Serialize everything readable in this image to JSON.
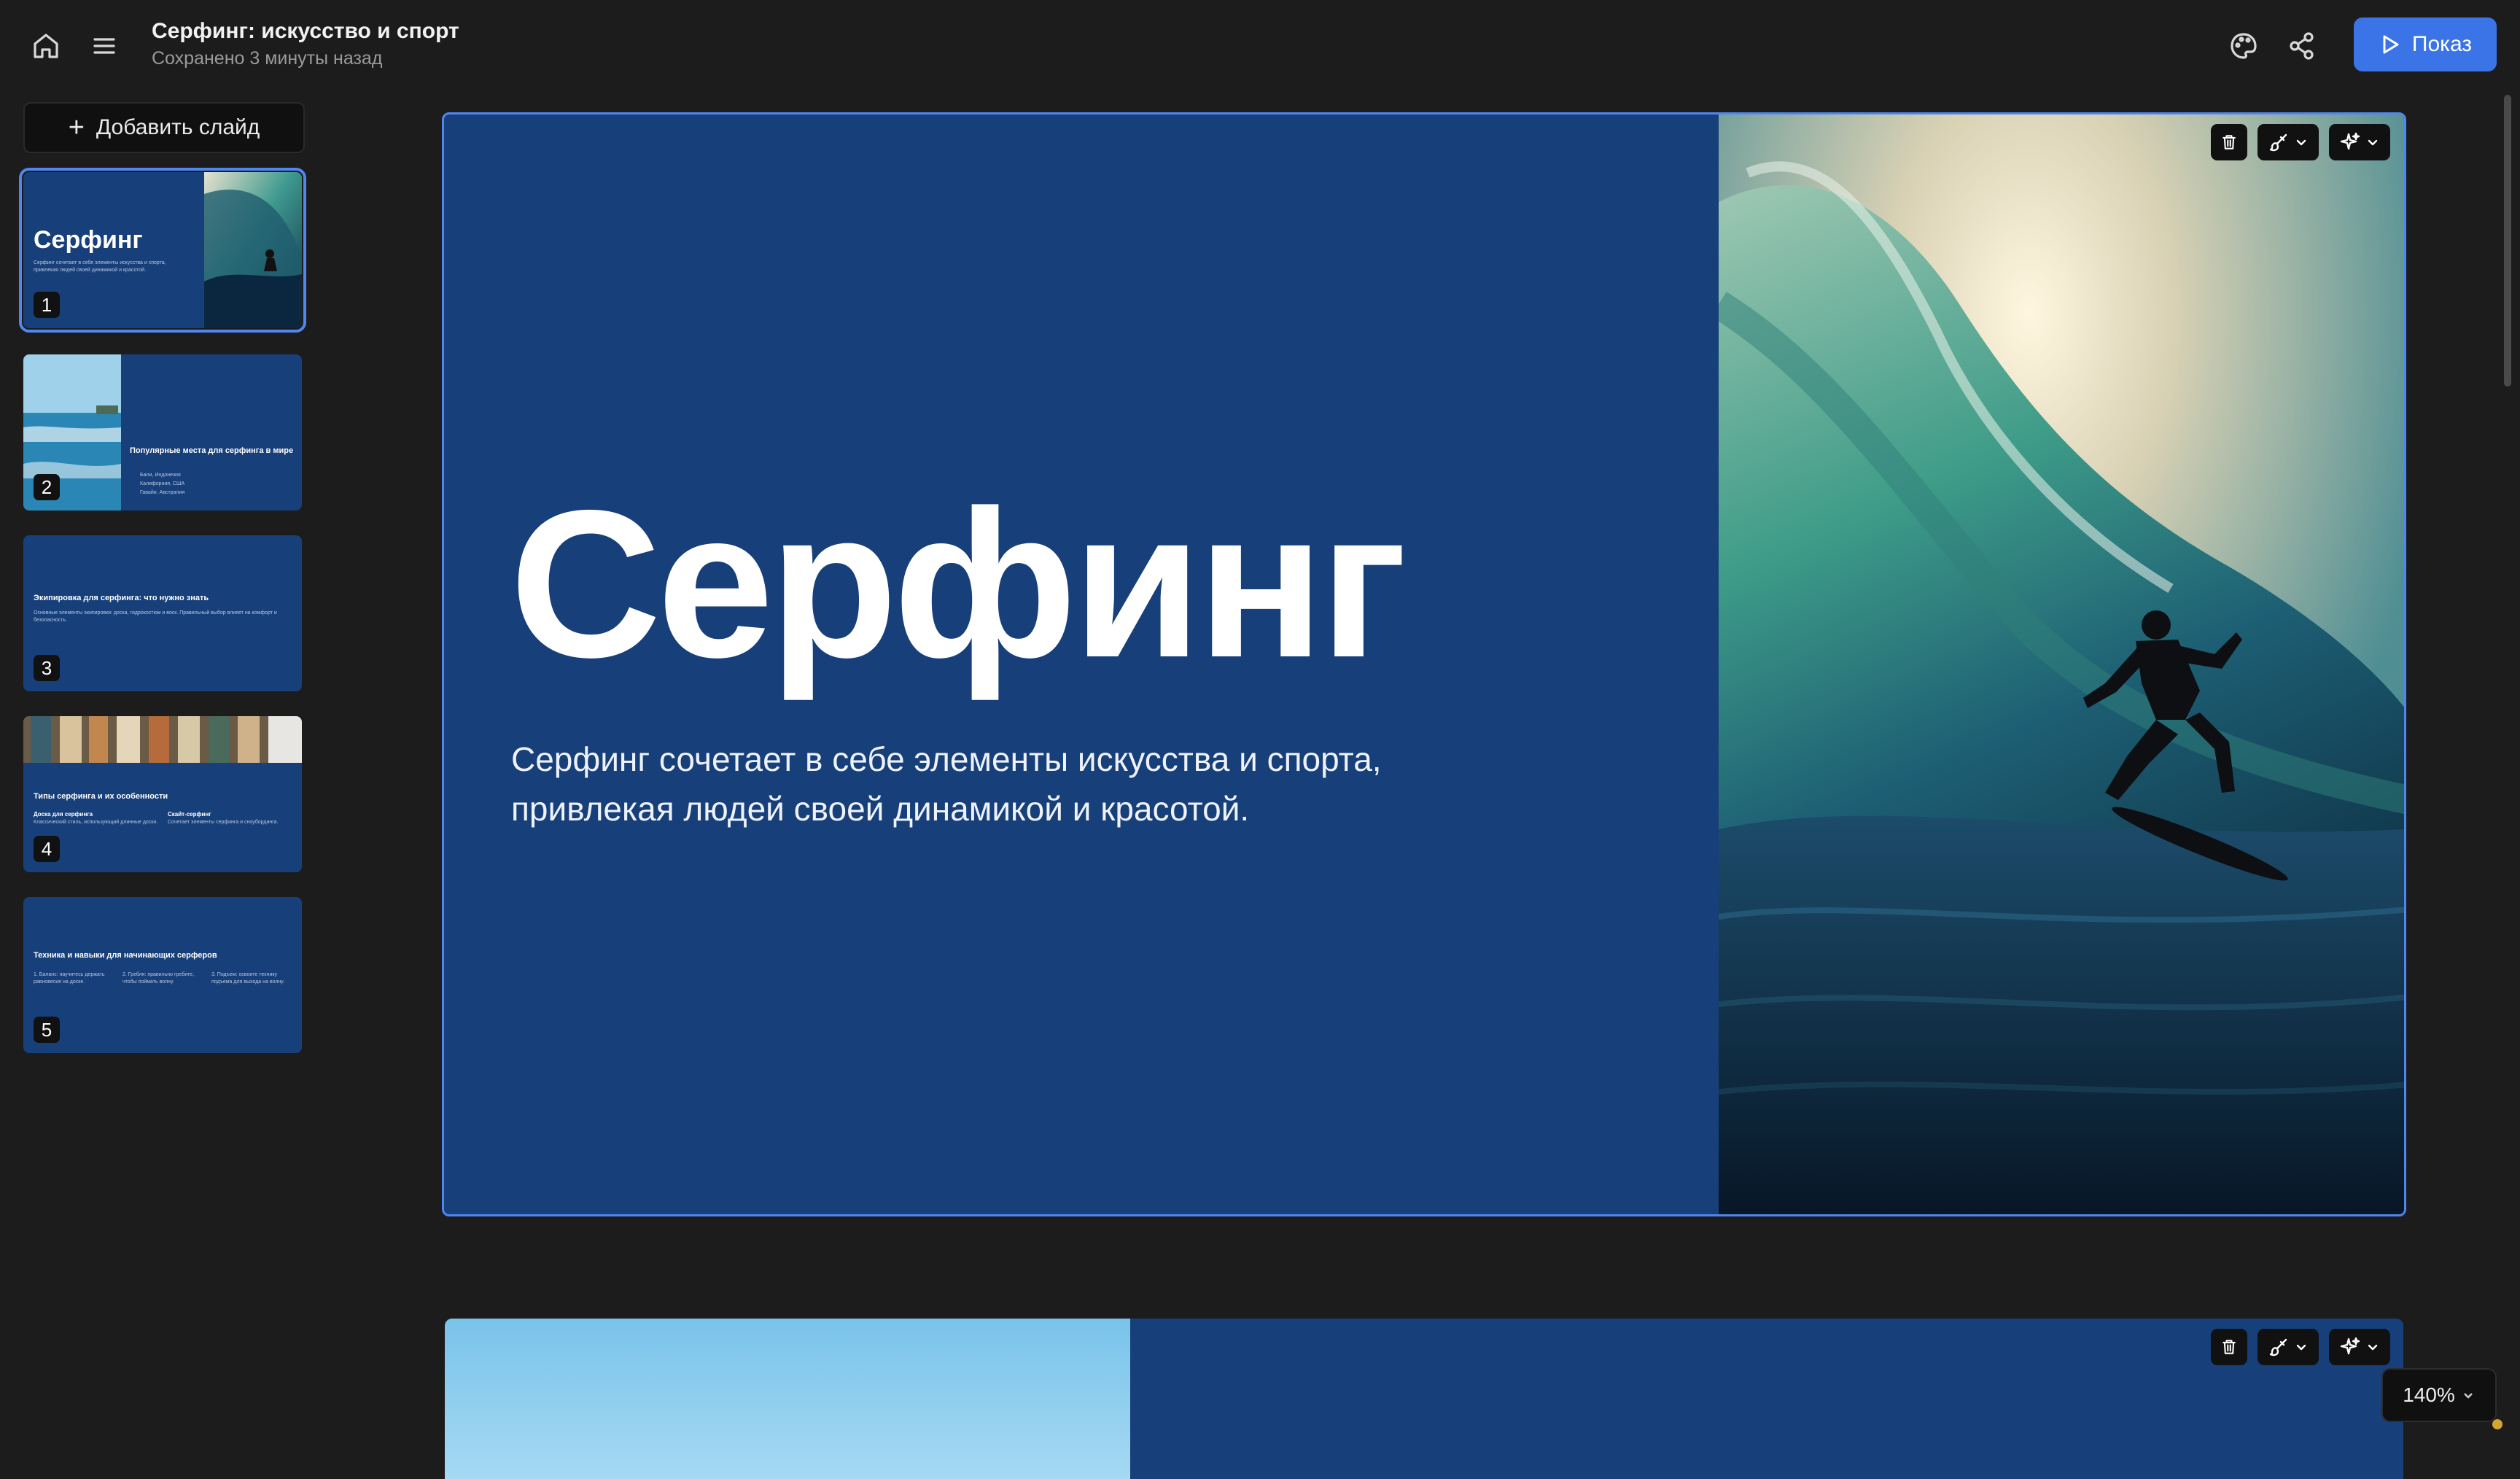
{
  "header": {
    "title": "Серфинг: искусство и спорт",
    "status": "Сохранено 3 минуты назад",
    "show_label": "Показ",
    "accent_color": "#3b74e6"
  },
  "sidebar": {
    "add_slide_label": "Добавить слайд",
    "slides": [
      {
        "num": "1",
        "title": "Серфинг",
        "text": "Серфинг сочетает в себе элементы искусства и спорта, привлекая людей своей динамикой и красотой."
      },
      {
        "num": "2",
        "title": "Популярные места для серфинга в мире",
        "bullets": [
          "Бали, Индонезия",
          "Калифорния, США",
          "Гавайи, Австралия"
        ]
      },
      {
        "num": "3",
        "title": "Экипировка для серфинга: что нужно знать",
        "text": "Основные элементы экипировки: доска, гидрокостюм и воск. Правильный выбор влияет на комфорт и безопасность."
      },
      {
        "num": "4",
        "title": "Типы серфинга и их особенности",
        "col1_title": "Доска для серфинга",
        "col1_text": "Классический стиль, использующий длинные доски.",
        "col2_title": "Скайт-серфинг",
        "col2_text": "Сочетает элементы серфинга и сноубординга."
      },
      {
        "num": "5",
        "title": "Техника и навыки для начинающих серферов",
        "steps": [
          "1. Баланс: научитесь держать равновесие на доске.",
          "2. Гребля: правильно гребите, чтобы поймать волну.",
          "3. Подъем: освоите технику подъема для выхода на волну."
        ]
      }
    ]
  },
  "slide": {
    "title": "Серфинг",
    "subtitle": "Серфинг сочетает в себе элементы искусства и спорта, привлекая людей своей динамикой и красотой.",
    "background": "#173f7a"
  },
  "icons": {
    "home": "home-icon",
    "menu": "menu-icon",
    "theme": "palette-icon",
    "share": "share-icon",
    "play": "play-icon",
    "delete": "trash-icon",
    "style": "brush-icon",
    "ai": "sparkle-icon"
  },
  "zoom": {
    "level": "140%"
  }
}
